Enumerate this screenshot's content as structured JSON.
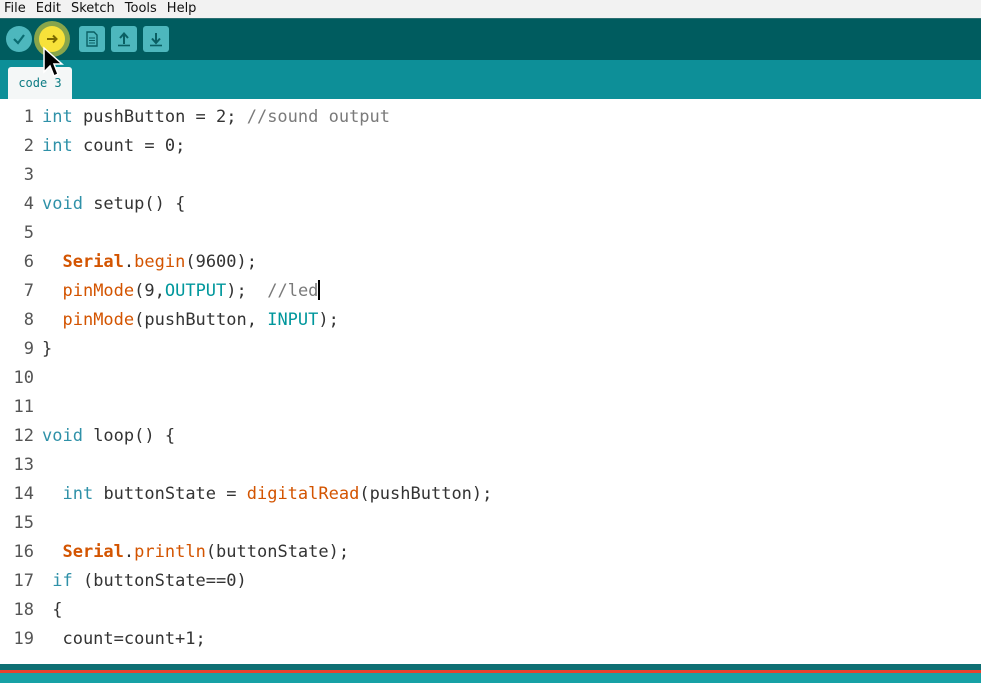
{
  "menu": {
    "items": [
      "File",
      "Edit",
      "Sketch",
      "Tools",
      "Help"
    ]
  },
  "toolbar": {
    "buttons": [
      {
        "name": "verify",
        "icon": "check-icon"
      },
      {
        "name": "upload",
        "icon": "arrow-right-icon"
      },
      {
        "name": "new",
        "icon": "file-icon"
      },
      {
        "name": "open",
        "icon": "arrow-up-icon"
      },
      {
        "name": "save",
        "icon": "arrow-down-icon"
      }
    ]
  },
  "tab": {
    "label": "code 3"
  },
  "editor": {
    "lines": [
      {
        "no": "1",
        "text": "int pushButton = 2; //sound output"
      },
      {
        "no": "2",
        "text": "int count = 0;"
      },
      {
        "no": "3",
        "text": ""
      },
      {
        "no": "4",
        "text": "void setup() {"
      },
      {
        "no": "5",
        "text": ""
      },
      {
        "no": "6",
        "text": "  Serial.begin(9600);"
      },
      {
        "no": "7",
        "text": "  pinMode(9,OUTPUT);  //led"
      },
      {
        "no": "8",
        "text": "  pinMode(pushButton, INPUT);"
      },
      {
        "no": "9",
        "text": "}"
      },
      {
        "no": "10",
        "text": ""
      },
      {
        "no": "11",
        "text": ""
      },
      {
        "no": "12",
        "text": "void loop() {"
      },
      {
        "no": "13",
        "text": ""
      },
      {
        "no": "14",
        "text": "  int buttonState = digitalRead(pushButton);"
      },
      {
        "no": "15",
        "text": ""
      },
      {
        "no": "16",
        "text": "  Serial.println(buttonState);"
      },
      {
        "no": "17",
        "text": " if (buttonState==0)"
      },
      {
        "no": "18",
        "text": " {"
      },
      {
        "no": "19",
        "text": "  count=count+1;"
      }
    ]
  },
  "colors": {
    "toolbar_bg": "#005c5f",
    "tabstrip_bg": "#0d8f98",
    "keyword": "#2f91a8",
    "function": "#d35400",
    "comment": "#7a7a7a"
  }
}
